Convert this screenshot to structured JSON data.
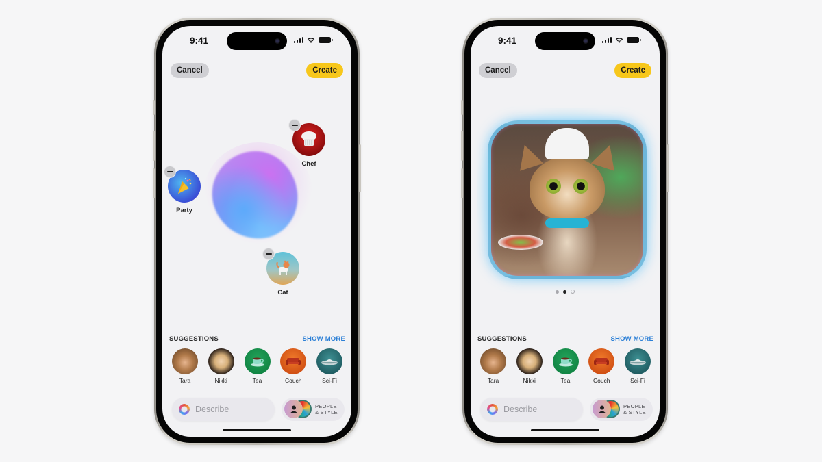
{
  "phones": [
    {
      "id": "left",
      "status_bar": {
        "time": "9:41"
      },
      "header": {
        "cancel_label": "Cancel",
        "create_label": "Create"
      },
      "concepts": [
        {
          "label": "Chef",
          "icon": "chef-hat-icon"
        },
        {
          "label": "Party",
          "icon": "party-popper-icon"
        },
        {
          "label": "Cat",
          "icon": "cat-icon"
        }
      ],
      "suggestions": {
        "title": "SUGGESTIONS",
        "show_more": "SHOW MORE",
        "items": [
          {
            "label": "Tara",
            "icon": "person-photo"
          },
          {
            "label": "Nikki",
            "icon": "person-photo"
          },
          {
            "label": "Tea",
            "icon": "teacup-icon"
          },
          {
            "label": "Couch",
            "icon": "couch-icon"
          },
          {
            "label": "Sci-Fi",
            "icon": "ufo-icon"
          }
        ]
      },
      "bottom": {
        "describe_placeholder": "Describe",
        "people_style_label_1": "PEOPLE",
        "people_style_label_2": "& STYLE"
      }
    },
    {
      "id": "right",
      "status_bar": {
        "time": "9:41"
      },
      "header": {
        "cancel_label": "Cancel",
        "create_label": "Create"
      },
      "generated_image": {
        "description": "Cartoon tabby cat wearing a chef hat and blue scarf",
        "page_count": 3,
        "current_page": 2
      },
      "suggestions": {
        "title": "SUGGESTIONS",
        "show_more": "SHOW MORE",
        "items": [
          {
            "label": "Tara",
            "icon": "person-photo"
          },
          {
            "label": "Nikki",
            "icon": "person-photo"
          },
          {
            "label": "Tea",
            "icon": "teacup-icon"
          },
          {
            "label": "Couch",
            "icon": "couch-icon"
          },
          {
            "label": "Sci-Fi",
            "icon": "ufo-icon"
          }
        ]
      },
      "bottom": {
        "describe_placeholder": "Describe",
        "people_style_label_1": "PEOPLE",
        "people_style_label_2": "& STYLE"
      }
    }
  ],
  "colors": {
    "create_button": "#f7c71b",
    "cancel_button": "#cfcfd3",
    "show_more_link": "#2b7fd6",
    "screen_background": "#f2f2f4"
  }
}
